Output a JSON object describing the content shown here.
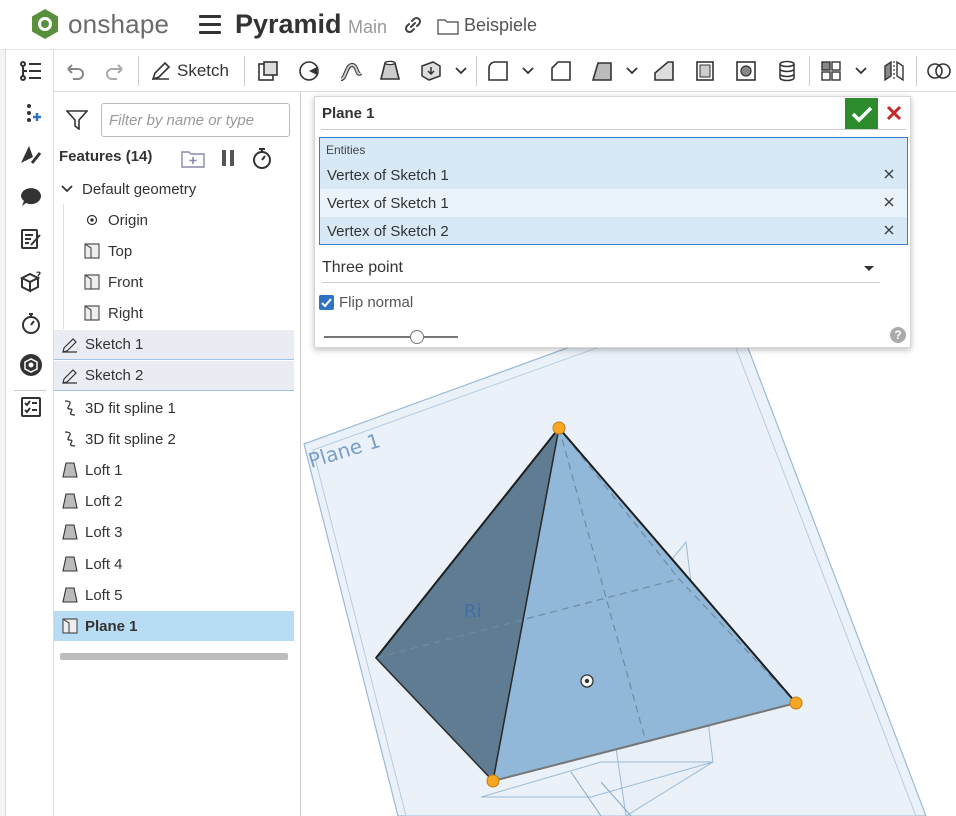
{
  "app": {
    "brand": "onshape",
    "document_title": "Pyramid",
    "branch": "Main",
    "folder": "Beispiele"
  },
  "toolbar": {
    "sketch_label": "Sketch"
  },
  "features": {
    "filter_placeholder": "Filter by name or type",
    "title": "Features (14)",
    "default_geometry": "Default geometry",
    "items": [
      {
        "label": "Origin",
        "icon": "origin-icon"
      },
      {
        "label": "Top",
        "icon": "plane-icon"
      },
      {
        "label": "Front",
        "icon": "plane-icon"
      },
      {
        "label": "Right",
        "icon": "plane-icon"
      },
      {
        "label": "Sketch 1",
        "icon": "sketch-icon"
      },
      {
        "label": "Sketch 2",
        "icon": "sketch-icon"
      },
      {
        "label": "3D fit spline 1",
        "icon": "spline-icon"
      },
      {
        "label": "3D fit spline 2",
        "icon": "spline-icon"
      },
      {
        "label": "Loft 1",
        "icon": "loft-icon"
      },
      {
        "label": "Loft 2",
        "icon": "loft-icon"
      },
      {
        "label": "Loft 3",
        "icon": "loft-icon"
      },
      {
        "label": "Loft 4",
        "icon": "loft-icon"
      },
      {
        "label": "Loft 5",
        "icon": "loft-icon"
      },
      {
        "label": "Plane 1",
        "icon": "plane-icon"
      }
    ]
  },
  "dialog": {
    "title": "Plane 1",
    "entities_label": "Entities",
    "entities": [
      "Vertex of Sketch 1",
      "Vertex of Sketch 1",
      "Vertex of Sketch 2"
    ],
    "type_value": "Three point",
    "flip_normal_label": "Flip normal",
    "flip_normal_checked": true,
    "help": "?"
  },
  "viewport": {
    "plane_label": "Plane 1",
    "right_plane_label": "Ri"
  },
  "colors": {
    "accent": "#2f73c2",
    "ok": "#2c8c2c",
    "cancel": "#c62828",
    "selected_row": "#b8dcf3",
    "vertex": "#f5a623"
  }
}
